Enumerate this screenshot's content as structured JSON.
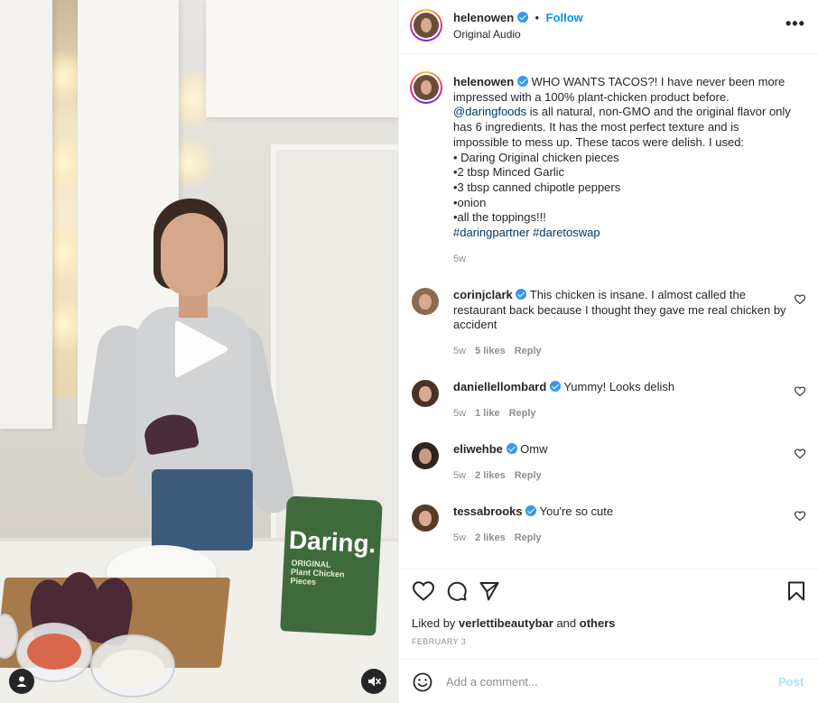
{
  "post": {
    "author": "helenowen",
    "follow_label": "Follow",
    "separator": "•",
    "audio": "Original Audio",
    "more_label": "•••"
  },
  "caption": {
    "username": "helenowen",
    "intro": "WHO WANTS TACOS?! I have never been more impressed with a 100% plant-chicken product before.",
    "mention": "@daringfoods",
    "body": "is all natural, non-GMO and the original flavor only has 6 ingredients. It has the most perfect texture and is impossible to mess up. These tacos were delish. I used:",
    "items": [
      "• Daring Original chicken pieces",
      "•2 tbsp Minced Garlic",
      "•3 tbsp canned chipotle peppers",
      "•onion",
      "•all the toppings!!!"
    ],
    "hashtags": "#daringpartner #daretoswap",
    "time": "5w"
  },
  "comments": [
    {
      "username": "corinjclark",
      "text": "This chicken is insane. I almost called the restaurant back because I thought they gave me real chicken by accident",
      "time": "5w",
      "likes": "5 likes",
      "reply": "Reply"
    },
    {
      "username": "daniellellombard",
      "text": "Yummy! Looks delish",
      "time": "5w",
      "likes": "1 like",
      "reply": "Reply"
    },
    {
      "username": "eliwehbe",
      "text": "Omw",
      "time": "5w",
      "likes": "2 likes",
      "reply": "Reply"
    },
    {
      "username": "tessabrooks",
      "text": "You're so cute",
      "time": "5w",
      "likes": "2 likes",
      "reply": "Reply"
    }
  ],
  "footer": {
    "liked_prefix": "Liked by",
    "liked_user": "verlettibeautybar",
    "liked_and": "and",
    "liked_others": "others",
    "date": "FEBRUARY 3",
    "comment_placeholder": "Add a comment...",
    "post_label": "Post"
  },
  "media": {
    "bag_brand": "Daring.",
    "bag_sub_1": "ORIGINAL",
    "bag_sub_2": "Plant Chicken",
    "bag_sub_3": "Pieces"
  },
  "colors": {
    "link_blue": "#0095f6",
    "mention_navy": "#00376b",
    "verified_blue": "#3897f0",
    "muted_gray": "#8e8e8e",
    "post_disabled": "#b2dffc"
  },
  "icons": {
    "verified": "verified-badge-icon",
    "more": "more-options-icon",
    "like": "heart-icon",
    "comment": "comment-bubble-icon",
    "share": "paper-plane-icon",
    "save": "bookmark-icon",
    "emoji": "emoji-smile-icon",
    "play": "play-icon",
    "tagged": "user-tag-icon",
    "mute": "speaker-muted-icon"
  }
}
